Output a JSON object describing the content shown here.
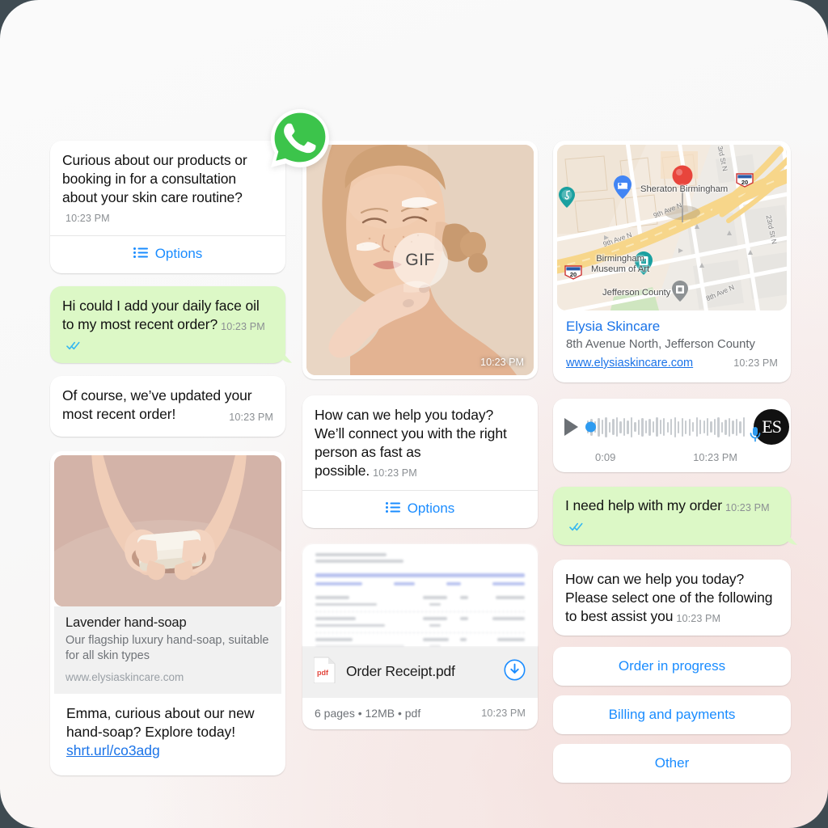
{
  "brand": {
    "app_icon": "whatsapp-icon",
    "accent_blue": "#1a8cff",
    "link_blue": "#1a73e8",
    "outgoing_bubble": "#dcf8c6",
    "avatar_initials": "ES"
  },
  "timestamps": {
    "default": "10:23 PM"
  },
  "left_column": {
    "greeting": {
      "message": "Curious about our products or booking in for a consultation about your skin care routine?",
      "time": "10:23 PM",
      "options_label": "Options",
      "options_icon": "list-icon"
    },
    "customer_reply": {
      "message": "Hi could I add your daily face oil to my most recent order?",
      "time": "10:23 PM",
      "status_icon": "double-check-icon"
    },
    "business_reply": {
      "message": "Of course, we’ve updated your most recent order!",
      "time": "10:23 PM"
    },
    "product_card": {
      "image_alt": "hands-holding-soap-bar",
      "title": "Lavender hand-soap",
      "description": "Our flagship luxury hand-soap, suitable for all skin types",
      "url": "www.elysiaskincare.com",
      "promo_message": "Emma, curious about our new hand-soap? Explore today!",
      "promo_link": "shrt.url/co3adg"
    }
  },
  "middle_column": {
    "gif_message": {
      "image_alt": "woman-applying-face-cream",
      "badge": "GIF",
      "time": "10:23 PM"
    },
    "help_message": {
      "message": "How can we help you today? We’ll connect you with the right person as fast as possible.",
      "time": "10:23 PM",
      "options_label": "Options",
      "options_icon": "list-icon"
    },
    "document": {
      "preview_alt": "blurred-invoice-preview",
      "file_icon": "pdf-icon",
      "file_name": "Order Receipt.pdf",
      "download_icon": "download-circle-icon",
      "meta": "6 pages • 12MB • pdf",
      "time": "10:23 PM"
    }
  },
  "right_column": {
    "location_card": {
      "map_alt": "birmingham-street-map",
      "place_name": "Elysia Skincare",
      "address": "8th Avenue North, Jefferson County",
      "url": "www.elysiaskincare.com",
      "time": "10:23 PM",
      "map_labels": {
        "pois": [
          "Sheraton Birmingham",
          "Birmingham Museum of Art",
          "Jefferson County"
        ],
        "streets": [
          "9th Ave N",
          "9th Ave N",
          "3rd St N",
          "23rd St N",
          "8th Ave N"
        ],
        "highways": [
          "20",
          "20"
        ],
        "pin": "destination-pin"
      }
    },
    "voice_note": {
      "play_icon": "play-icon",
      "duration": "0:09",
      "time": "10:23 PM",
      "avatar_initials": "ES",
      "mic_icon": "microphone-icon"
    },
    "customer_message": {
      "message": "I need help with my order",
      "time": "10:23 PM",
      "status_icon": "double-check-icon"
    },
    "menu_message": {
      "message": "How can we help you today? Please select one of the following to best assist you",
      "time": "10:23 PM"
    },
    "quick_replies": [
      {
        "label": "Order in progress"
      },
      {
        "label": "Billing and payments"
      },
      {
        "label": "Other"
      }
    ]
  }
}
